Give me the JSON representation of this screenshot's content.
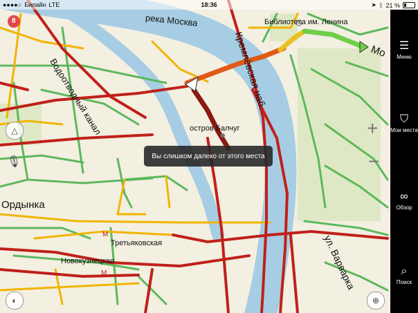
{
  "status_bar": {
    "carrier": "Билайн",
    "network": "LTE",
    "time": "18:36",
    "battery": "21 %"
  },
  "sidebar": {
    "menu_label": "Меню",
    "places_label": "Мои места",
    "overview_label": "Обзор",
    "search_label": "Поиск"
  },
  "map": {
    "labels": {
      "river_moskva": "река Москва",
      "vodootvodny": "Водоотводный канал",
      "kremlevskaya": "Кремлёвская наб.",
      "library": "Библиотека им. Ленина",
      "ostrov": "остров Балчуг",
      "ordynka": "Ордынка",
      "tretyakovskaya": "Третьяковская",
      "novokuznetskaya": "Новокузнецкая",
      "varvarka": "ул. Варварка",
      "mo": "Мо"
    },
    "notification_count": "8",
    "toast": "Вы слишком далеко от этого места",
    "colors": {
      "green": "#5cb85c",
      "yellow": "#f0b400",
      "red": "#c0201a",
      "dark_red": "#8b1a12",
      "river": "#a6cde3",
      "land": "#f3efe1"
    }
  }
}
